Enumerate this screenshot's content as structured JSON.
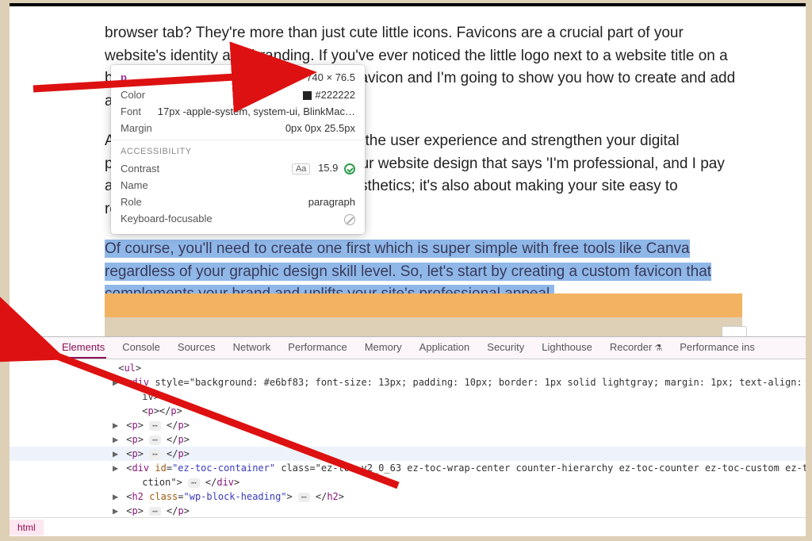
{
  "article": {
    "p1": "browser tab? They're more than just cute little icons. Favicons are a crucial part of your website's identity and branding. If you've ever noticed the little logo next to a website title on a browser tab or in bookmarks, that's a favicon and I'm going to show you how to create and add a favicon to your website.",
    "p2": "Adding one to your site helps enhance the user experience and strengthen your digital presence. It's that finishing touch to your website design that says 'I'm professional, and I pay attention to detail'. It isn't just about aesthetics; it's also about making your site easy to recognize, inviting users to return.",
    "p3": "Of course, you'll need to create one first which is super simple with free tools like Canva regardless of your graphic design skill level. So, let's start by creating a custom favicon that complements your brand and uplifts your site's professional appeal."
  },
  "tooltip": {
    "tag": "p",
    "dimensions": "740 × 76.5",
    "rows": {
      "color_label": "Color",
      "color_value": "#222222",
      "font_label": "Font",
      "font_value": "17px -apple-system, system-ui, BlinkMac…",
      "margin_label": "Margin",
      "margin_value": "0px 0px 25.5px"
    },
    "accessibility_heading": "ACCESSIBILITY",
    "a11y": {
      "contrast_label": "Contrast",
      "contrast_aa": "Aa",
      "contrast_value": "15.9",
      "name_label": "Name",
      "role_label": "Role",
      "role_value": "paragraph",
      "kbd_label": "Keyboard-focusable"
    }
  },
  "devtools": {
    "tabs": [
      "Elements",
      "Console",
      "Sources",
      "Network",
      "Performance",
      "Memory",
      "Application",
      "Security",
      "Lighthouse",
      "Recorder",
      "Performance ins"
    ],
    "active_tab": "Elements",
    "dom_lines": [
      {
        "indent": 120,
        "tri": "",
        "html": "<ul>"
      },
      {
        "indent": 130,
        "tri": "▶",
        "html": "<div style=\"background: #e6bf83; font-size: 13px; padding: 10px; border: 1px solid lightgray; margin: 1px; text-align: cent",
        "close": ""
      },
      {
        "indent": 150,
        "tri": "",
        "html": "iv>"
      },
      {
        "indent": 150,
        "tri": "",
        "html": "<p></p>"
      },
      {
        "indent": 130,
        "tri": "▶",
        "html": "<p> … </p>"
      },
      {
        "indent": 130,
        "tri": "▶",
        "html": "<p> … </p>"
      },
      {
        "indent": 130,
        "tri": "▶",
        "html": "<p> … </p>",
        "hl": true
      },
      {
        "indent": 130,
        "tri": "▶",
        "html": "<div id=\"ez-toc-container\" class=\"ez-toc-v2_0_63 ez-toc-wrap-center counter-hierarchy ez-toc-counter ez-toc-custom ez-toc-c",
        "close": ""
      },
      {
        "indent": 150,
        "tri": "",
        "html": "ction\"> … </div>"
      },
      {
        "indent": 130,
        "tri": "▶",
        "html": "<h2 class=\"wp-block-heading\"> … </h2>"
      },
      {
        "indent": 130,
        "tri": "▶",
        "html": "<p> … </p>"
      }
    ],
    "breadcrumb": "html"
  }
}
